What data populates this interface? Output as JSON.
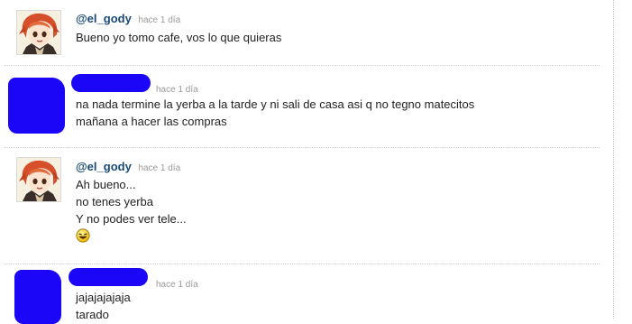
{
  "comments": [
    {
      "user": "@el_gody",
      "time": "hace 1 día",
      "lines": [
        "Bueno yo tomo cafe, vos lo que quieras"
      ]
    },
    {
      "user": "",
      "time": "hace 1 día",
      "lines": [
        "na nada termine la yerba a la tarde y ni sali de casa asi q no tegno matecitos",
        "mañana a hacer las compras"
      ]
    },
    {
      "user": "@el_gody",
      "time": "hace 1 día",
      "lines": [
        "Ah bueno...",
        "no tenes yerba",
        "Y no podes ver tele..."
      ],
      "emoticon": "laughing-smiley-icon"
    },
    {
      "user": "",
      "time": "hace 1 día",
      "lines": [
        "jajajajajaja",
        "tarado"
      ]
    }
  ],
  "colors": {
    "username": "#1a4a77",
    "timestamp": "#9a9a9a",
    "redaction": "#1b06f7",
    "divider": "#cfcfcf"
  }
}
